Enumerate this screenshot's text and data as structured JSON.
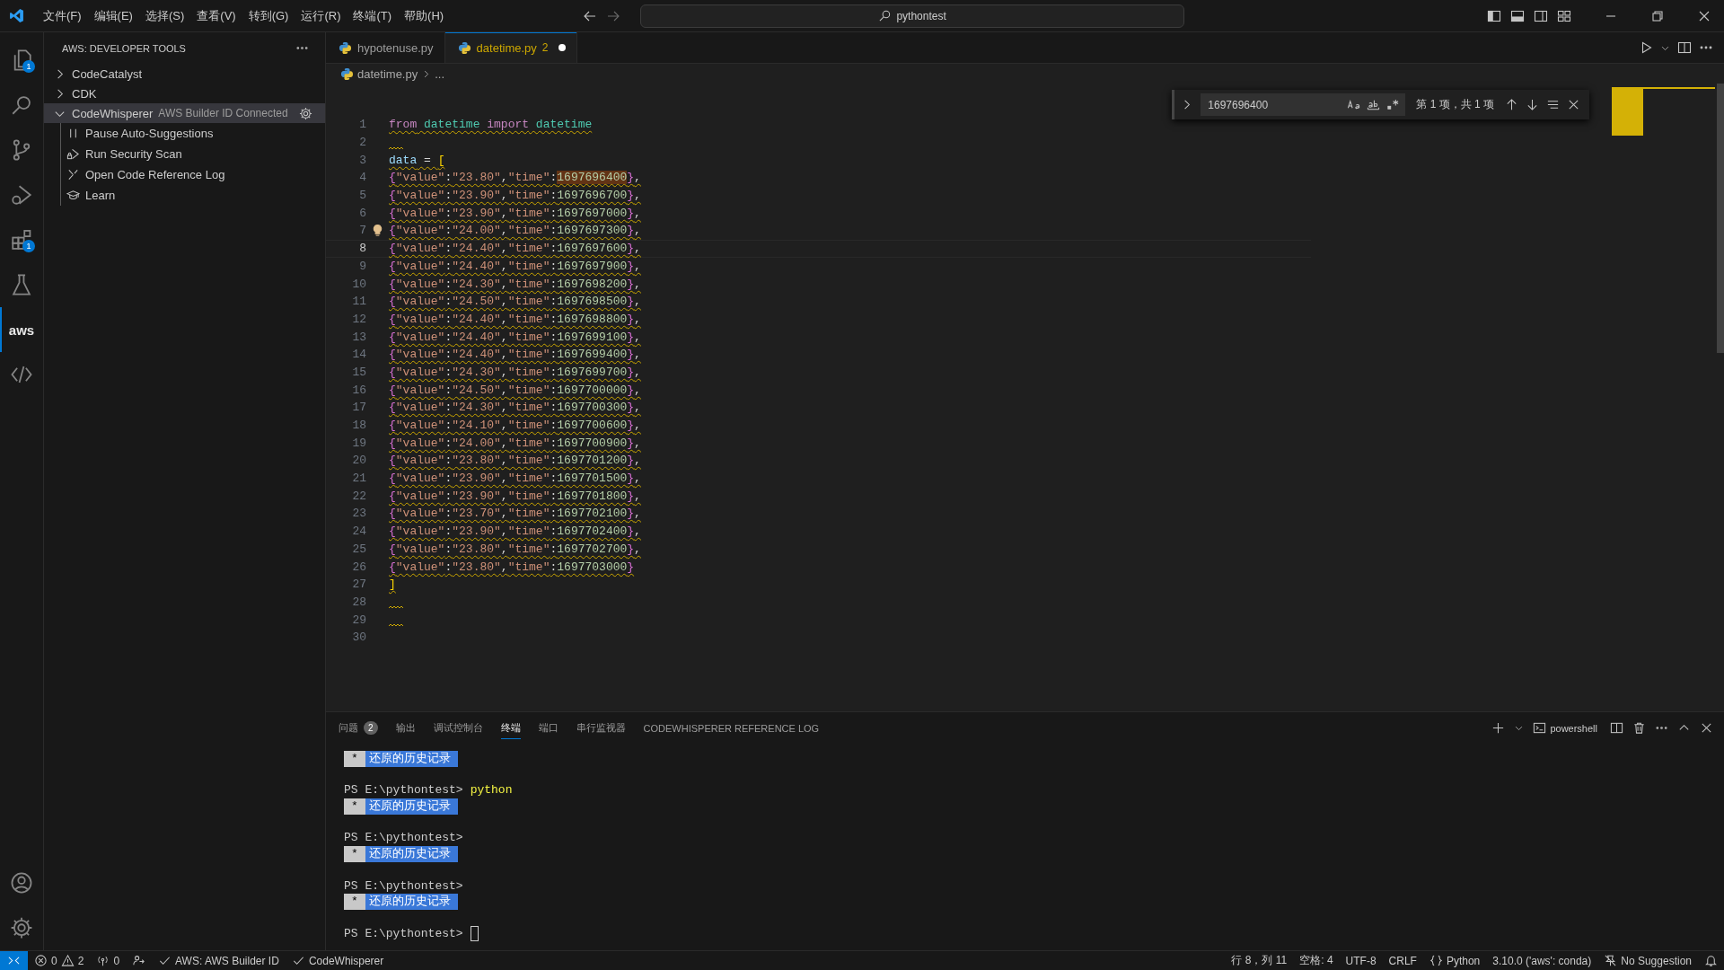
{
  "title_bar": {
    "menus": [
      "文件(F)",
      "编辑(E)",
      "选择(S)",
      "查看(V)",
      "转到(G)",
      "运行(R)",
      "终端(T)",
      "帮助(H)"
    ],
    "search": "pythontest"
  },
  "activity_bar": {
    "items": [
      {
        "kind": "files",
        "badge": "1",
        "selected": false
      },
      {
        "kind": "search",
        "selected": false
      },
      {
        "kind": "source-control",
        "selected": false
      },
      {
        "kind": "run-debug",
        "selected": false
      },
      {
        "kind": "extensions",
        "badge": "1",
        "selected": false
      },
      {
        "kind": "testing",
        "selected": false
      },
      {
        "kind": "aws",
        "label": "aws",
        "selected": true
      },
      {
        "kind": "code",
        "selected": false
      }
    ],
    "bottom": [
      {
        "kind": "account"
      },
      {
        "kind": "settings"
      }
    ]
  },
  "sidebar": {
    "title": "AWS: DEVELOPER TOOLS",
    "items": [
      {
        "label": "CodeCatalyst",
        "expanded": false,
        "selected": false
      },
      {
        "label": "CDK",
        "expanded": false,
        "selected": false
      },
      {
        "label": "CodeWhisperer",
        "description": "AWS Builder ID Connected",
        "expanded": true,
        "selected": true,
        "children": [
          {
            "kind": "pause",
            "label": "Pause Auto-Suggestions"
          },
          {
            "kind": "security-scan",
            "label": "Run Security Scan"
          },
          {
            "kind": "reference-log",
            "label": "Open Code Reference Log"
          },
          {
            "kind": "learn",
            "label": "Learn"
          }
        ]
      }
    ]
  },
  "editor": {
    "tabs": [
      {
        "label": "hypotenuse.py",
        "selected": false,
        "modified": false
      },
      {
        "label": "datetime.py",
        "problems": "2",
        "selected": true,
        "modified": true
      }
    ],
    "breadcrumb": [
      "datetime.py",
      "..."
    ],
    "find": {
      "value": "1697696400",
      "match_case": false,
      "whole_word": false,
      "regex": false,
      "result": "第 1 项，共 1 项"
    },
    "lines": [
      {
        "number": "1",
        "warning": true,
        "current": false,
        "tokens": [
          {
            "kind": "kw",
            "text": "from"
          },
          {
            "kind": "mod",
            "text": " datetime"
          },
          {
            "kind": "kw",
            "text": " import"
          },
          {
            "kind": "mod",
            "text": " datetime"
          }
        ]
      },
      {
        "number": "2",
        "warning": true,
        "current": false
      },
      {
        "number": "3",
        "warning": true,
        "current": false,
        "tokens": [
          {
            "kind": "var",
            "text": "data"
          },
          {
            "kind": "op",
            "text": " = "
          },
          {
            "kind": "bracket",
            "text": "["
          }
        ]
      },
      {
        "number": "4",
        "warning": true,
        "current": false,
        "tokens": [
          {
            "kind": "brace",
            "text": "{"
          },
          {
            "kind": "str",
            "text": "\"value\""
          },
          {
            "kind": "op",
            "text": ":"
          },
          {
            "kind": "str",
            "text": "\"23.80\""
          },
          {
            "kind": "op",
            "text": ","
          },
          {
            "kind": "str",
            "text": "\"time\""
          },
          {
            "kind": "op",
            "text": ":"
          },
          {
            "kind": "num",
            "text": "1697696400",
            "match": true
          },
          {
            "kind": "brace",
            "text": "}"
          },
          {
            "kind": "op",
            "text": ","
          }
        ]
      },
      {
        "number": "5",
        "warning": true,
        "current": false,
        "tokens": [
          {
            "kind": "brace",
            "text": "{"
          },
          {
            "kind": "str",
            "text": "\"value\""
          },
          {
            "kind": "op",
            "text": ":"
          },
          {
            "kind": "str",
            "text": "\"23.90\""
          },
          {
            "kind": "op",
            "text": ","
          },
          {
            "kind": "str",
            "text": "\"time\""
          },
          {
            "kind": "op",
            "text": ":"
          },
          {
            "kind": "num",
            "text": "1697696700"
          },
          {
            "kind": "brace",
            "text": "}"
          },
          {
            "kind": "op",
            "text": ","
          }
        ]
      },
      {
        "number": "6",
        "warning": true,
        "current": false,
        "tokens": [
          {
            "kind": "brace",
            "text": "{"
          },
          {
            "kind": "str",
            "text": "\"value\""
          },
          {
            "kind": "op",
            "text": ":"
          },
          {
            "kind": "str",
            "text": "\"23.90\""
          },
          {
            "kind": "op",
            "text": ","
          },
          {
            "kind": "str",
            "text": "\"time\""
          },
          {
            "kind": "op",
            "text": ":"
          },
          {
            "kind": "num",
            "text": "1697697000"
          },
          {
            "kind": "brace",
            "text": "}"
          },
          {
            "kind": "op",
            "text": ","
          }
        ]
      },
      {
        "number": "7",
        "warning": true,
        "current": false,
        "lightbulb": true,
        "tokens": [
          {
            "kind": "brace",
            "text": "{"
          },
          {
            "kind": "str",
            "text": "\"value\""
          },
          {
            "kind": "op",
            "text": ":"
          },
          {
            "kind": "str",
            "text": "\"24.00\""
          },
          {
            "kind": "op",
            "text": ","
          },
          {
            "kind": "str",
            "text": "\"time\""
          },
          {
            "kind": "op",
            "text": ":"
          },
          {
            "kind": "num",
            "text": "1697697300"
          },
          {
            "kind": "brace",
            "text": "}"
          },
          {
            "kind": "op",
            "text": ","
          }
        ]
      },
      {
        "number": "8",
        "warning": true,
        "current": true,
        "tokens": [
          {
            "kind": "brace",
            "text": "{"
          },
          {
            "kind": "str",
            "text": "\"value\""
          },
          {
            "kind": "op",
            "text": ":"
          },
          {
            "kind": "str",
            "text": "\"24.40\""
          },
          {
            "kind": "op",
            "text": ","
          },
          {
            "kind": "str",
            "text": "\"time\""
          },
          {
            "kind": "op",
            "text": ":"
          },
          {
            "kind": "num",
            "text": "1697697600"
          },
          {
            "kind": "brace",
            "text": "}"
          },
          {
            "kind": "op",
            "text": ","
          }
        ]
      },
      {
        "number": "9",
        "warning": true,
        "current": false,
        "tokens": [
          {
            "kind": "brace",
            "text": "{"
          },
          {
            "kind": "str",
            "text": "\"value\""
          },
          {
            "kind": "op",
            "text": ":"
          },
          {
            "kind": "str",
            "text": "\"24.40\""
          },
          {
            "kind": "op",
            "text": ","
          },
          {
            "kind": "str",
            "text": "\"time\""
          },
          {
            "kind": "op",
            "text": ":"
          },
          {
            "kind": "num",
            "text": "1697697900"
          },
          {
            "kind": "brace",
            "text": "}"
          },
          {
            "kind": "op",
            "text": ","
          }
        ]
      },
      {
        "number": "10",
        "warning": true,
        "current": false,
        "tokens": [
          {
            "kind": "brace",
            "text": "{"
          },
          {
            "kind": "str",
            "text": "\"value\""
          },
          {
            "kind": "op",
            "text": ":"
          },
          {
            "kind": "str",
            "text": "\"24.30\""
          },
          {
            "kind": "op",
            "text": ","
          },
          {
            "kind": "str",
            "text": "\"time\""
          },
          {
            "kind": "op",
            "text": ":"
          },
          {
            "kind": "num",
            "text": "1697698200"
          },
          {
            "kind": "brace",
            "text": "}"
          },
          {
            "kind": "op",
            "text": ","
          }
        ]
      },
      {
        "number": "11",
        "warning": true,
        "current": false,
        "tokens": [
          {
            "kind": "brace",
            "text": "{"
          },
          {
            "kind": "str",
            "text": "\"value\""
          },
          {
            "kind": "op",
            "text": ":"
          },
          {
            "kind": "str",
            "text": "\"24.50\""
          },
          {
            "kind": "op",
            "text": ","
          },
          {
            "kind": "str",
            "text": "\"time\""
          },
          {
            "kind": "op",
            "text": ":"
          },
          {
            "kind": "num",
            "text": "1697698500"
          },
          {
            "kind": "brace",
            "text": "}"
          },
          {
            "kind": "op",
            "text": ","
          }
        ]
      },
      {
        "number": "12",
        "warning": true,
        "current": false,
        "tokens": [
          {
            "kind": "brace",
            "text": "{"
          },
          {
            "kind": "str",
            "text": "\"value\""
          },
          {
            "kind": "op",
            "text": ":"
          },
          {
            "kind": "str",
            "text": "\"24.40\""
          },
          {
            "kind": "op",
            "text": ","
          },
          {
            "kind": "str",
            "text": "\"time\""
          },
          {
            "kind": "op",
            "text": ":"
          },
          {
            "kind": "num",
            "text": "1697698800"
          },
          {
            "kind": "brace",
            "text": "}"
          },
          {
            "kind": "op",
            "text": ","
          }
        ]
      },
      {
        "number": "13",
        "warning": true,
        "current": false,
        "tokens": [
          {
            "kind": "brace",
            "text": "{"
          },
          {
            "kind": "str",
            "text": "\"value\""
          },
          {
            "kind": "op",
            "text": ":"
          },
          {
            "kind": "str",
            "text": "\"24.40\""
          },
          {
            "kind": "op",
            "text": ","
          },
          {
            "kind": "str",
            "text": "\"time\""
          },
          {
            "kind": "op",
            "text": ":"
          },
          {
            "kind": "num",
            "text": "1697699100"
          },
          {
            "kind": "brace",
            "text": "}"
          },
          {
            "kind": "op",
            "text": ","
          }
        ]
      },
      {
        "number": "14",
        "warning": true,
        "current": false,
        "tokens": [
          {
            "kind": "brace",
            "text": "{"
          },
          {
            "kind": "str",
            "text": "\"value\""
          },
          {
            "kind": "op",
            "text": ":"
          },
          {
            "kind": "str",
            "text": "\"24.40\""
          },
          {
            "kind": "op",
            "text": ","
          },
          {
            "kind": "str",
            "text": "\"time\""
          },
          {
            "kind": "op",
            "text": ":"
          },
          {
            "kind": "num",
            "text": "1697699400"
          },
          {
            "kind": "brace",
            "text": "}"
          },
          {
            "kind": "op",
            "text": ","
          }
        ]
      },
      {
        "number": "15",
        "warning": true,
        "current": false,
        "tokens": [
          {
            "kind": "brace",
            "text": "{"
          },
          {
            "kind": "str",
            "text": "\"value\""
          },
          {
            "kind": "op",
            "text": ":"
          },
          {
            "kind": "str",
            "text": "\"24.30\""
          },
          {
            "kind": "op",
            "text": ","
          },
          {
            "kind": "str",
            "text": "\"time\""
          },
          {
            "kind": "op",
            "text": ":"
          },
          {
            "kind": "num",
            "text": "1697699700"
          },
          {
            "kind": "brace",
            "text": "}"
          },
          {
            "kind": "op",
            "text": ","
          }
        ]
      },
      {
        "number": "16",
        "warning": true,
        "current": false,
        "tokens": [
          {
            "kind": "brace",
            "text": "{"
          },
          {
            "kind": "str",
            "text": "\"value\""
          },
          {
            "kind": "op",
            "text": ":"
          },
          {
            "kind": "str",
            "text": "\"24.50\""
          },
          {
            "kind": "op",
            "text": ","
          },
          {
            "kind": "str",
            "text": "\"time\""
          },
          {
            "kind": "op",
            "text": ":"
          },
          {
            "kind": "num",
            "text": "1697700000"
          },
          {
            "kind": "brace",
            "text": "}"
          },
          {
            "kind": "op",
            "text": ","
          }
        ]
      },
      {
        "number": "17",
        "warning": true,
        "current": false,
        "tokens": [
          {
            "kind": "brace",
            "text": "{"
          },
          {
            "kind": "str",
            "text": "\"value\""
          },
          {
            "kind": "op",
            "text": ":"
          },
          {
            "kind": "str",
            "text": "\"24.30\""
          },
          {
            "kind": "op",
            "text": ","
          },
          {
            "kind": "str",
            "text": "\"time\""
          },
          {
            "kind": "op",
            "text": ":"
          },
          {
            "kind": "num",
            "text": "1697700300"
          },
          {
            "kind": "brace",
            "text": "}"
          },
          {
            "kind": "op",
            "text": ","
          }
        ]
      },
      {
        "number": "18",
        "warning": true,
        "current": false,
        "tokens": [
          {
            "kind": "brace",
            "text": "{"
          },
          {
            "kind": "str",
            "text": "\"value\""
          },
          {
            "kind": "op",
            "text": ":"
          },
          {
            "kind": "str",
            "text": "\"24.10\""
          },
          {
            "kind": "op",
            "text": ","
          },
          {
            "kind": "str",
            "text": "\"time\""
          },
          {
            "kind": "op",
            "text": ":"
          },
          {
            "kind": "num",
            "text": "1697700600"
          },
          {
            "kind": "brace",
            "text": "}"
          },
          {
            "kind": "op",
            "text": ","
          }
        ]
      },
      {
        "number": "19",
        "warning": true,
        "current": false,
        "tokens": [
          {
            "kind": "brace",
            "text": "{"
          },
          {
            "kind": "str",
            "text": "\"value\""
          },
          {
            "kind": "op",
            "text": ":"
          },
          {
            "kind": "str",
            "text": "\"24.00\""
          },
          {
            "kind": "op",
            "text": ","
          },
          {
            "kind": "str",
            "text": "\"time\""
          },
          {
            "kind": "op",
            "text": ":"
          },
          {
            "kind": "num",
            "text": "1697700900"
          },
          {
            "kind": "brace",
            "text": "}"
          },
          {
            "kind": "op",
            "text": ","
          }
        ]
      },
      {
        "number": "20",
        "warning": true,
        "current": false,
        "tokens": [
          {
            "kind": "brace",
            "text": "{"
          },
          {
            "kind": "str",
            "text": "\"value\""
          },
          {
            "kind": "op",
            "text": ":"
          },
          {
            "kind": "str",
            "text": "\"23.80\""
          },
          {
            "kind": "op",
            "text": ","
          },
          {
            "kind": "str",
            "text": "\"time\""
          },
          {
            "kind": "op",
            "text": ":"
          },
          {
            "kind": "num",
            "text": "1697701200"
          },
          {
            "kind": "brace",
            "text": "}"
          },
          {
            "kind": "op",
            "text": ","
          }
        ]
      },
      {
        "number": "21",
        "warning": true,
        "current": false,
        "tokens": [
          {
            "kind": "brace",
            "text": "{"
          },
          {
            "kind": "str",
            "text": "\"value\""
          },
          {
            "kind": "op",
            "text": ":"
          },
          {
            "kind": "str",
            "text": "\"23.90\""
          },
          {
            "kind": "op",
            "text": ","
          },
          {
            "kind": "str",
            "text": "\"time\""
          },
          {
            "kind": "op",
            "text": ":"
          },
          {
            "kind": "num",
            "text": "1697701500"
          },
          {
            "kind": "brace",
            "text": "}"
          },
          {
            "kind": "op",
            "text": ","
          }
        ]
      },
      {
        "number": "22",
        "warning": true,
        "current": false,
        "tokens": [
          {
            "kind": "brace",
            "text": "{"
          },
          {
            "kind": "str",
            "text": "\"value\""
          },
          {
            "kind": "op",
            "text": ":"
          },
          {
            "kind": "str",
            "text": "\"23.90\""
          },
          {
            "kind": "op",
            "text": ","
          },
          {
            "kind": "str",
            "text": "\"time\""
          },
          {
            "kind": "op",
            "text": ":"
          },
          {
            "kind": "num",
            "text": "1697701800"
          },
          {
            "kind": "brace",
            "text": "}"
          },
          {
            "kind": "op",
            "text": ","
          }
        ]
      },
      {
        "number": "23",
        "warning": true,
        "current": false,
        "tokens": [
          {
            "kind": "brace",
            "text": "{"
          },
          {
            "kind": "str",
            "text": "\"value\""
          },
          {
            "kind": "op",
            "text": ":"
          },
          {
            "kind": "str",
            "text": "\"23.70\""
          },
          {
            "kind": "op",
            "text": ","
          },
          {
            "kind": "str",
            "text": "\"time\""
          },
          {
            "kind": "op",
            "text": ":"
          },
          {
            "kind": "num",
            "text": "1697702100"
          },
          {
            "kind": "brace",
            "text": "}"
          },
          {
            "kind": "op",
            "text": ","
          }
        ]
      },
      {
        "number": "24",
        "warning": true,
        "current": false,
        "tokens": [
          {
            "kind": "brace",
            "text": "{"
          },
          {
            "kind": "str",
            "text": "\"value\""
          },
          {
            "kind": "op",
            "text": ":"
          },
          {
            "kind": "str",
            "text": "\"23.90\""
          },
          {
            "kind": "op",
            "text": ","
          },
          {
            "kind": "str",
            "text": "\"time\""
          },
          {
            "kind": "op",
            "text": ":"
          },
          {
            "kind": "num",
            "text": "1697702400"
          },
          {
            "kind": "brace",
            "text": "}"
          },
          {
            "kind": "op",
            "text": ","
          }
        ]
      },
      {
        "number": "25",
        "warning": true,
        "current": false,
        "tokens": [
          {
            "kind": "brace",
            "text": "{"
          },
          {
            "kind": "str",
            "text": "\"value\""
          },
          {
            "kind": "op",
            "text": ":"
          },
          {
            "kind": "str",
            "text": "\"23.80\""
          },
          {
            "kind": "op",
            "text": ","
          },
          {
            "kind": "str",
            "text": "\"time\""
          },
          {
            "kind": "op",
            "text": ":"
          },
          {
            "kind": "num",
            "text": "1697702700"
          },
          {
            "kind": "brace",
            "text": "}"
          },
          {
            "kind": "op",
            "text": ","
          }
        ]
      },
      {
        "number": "26",
        "warning": true,
        "current": false,
        "tokens": [
          {
            "kind": "brace",
            "text": "{"
          },
          {
            "kind": "str",
            "text": "\"value\""
          },
          {
            "kind": "op",
            "text": ":"
          },
          {
            "kind": "str",
            "text": "\"23.80\""
          },
          {
            "kind": "op",
            "text": ","
          },
          {
            "kind": "str",
            "text": "\"time\""
          },
          {
            "kind": "op",
            "text": ":"
          },
          {
            "kind": "num",
            "text": "1697703000"
          },
          {
            "kind": "brace",
            "text": "}"
          }
        ]
      },
      {
        "number": "27",
        "warning": true,
        "current": false,
        "tokens": [
          {
            "kind": "bracket",
            "text": "]"
          }
        ]
      },
      {
        "number": "28",
        "warning": true,
        "current": false
      },
      {
        "number": "29",
        "warning": true,
        "current": false
      },
      {
        "number": "30",
        "warning": false,
        "current": false
      }
    ]
  },
  "panel": {
    "tabs": [
      {
        "label": "问题",
        "badge": "2",
        "selected": false
      },
      {
        "label": "输出",
        "selected": false
      },
      {
        "label": "调试控制台",
        "selected": false
      },
      {
        "label": "终端",
        "selected": true
      },
      {
        "label": "端口",
        "selected": false
      },
      {
        "label": "串行监视器",
        "selected": false
      },
      {
        "label": "CODEWHISPERER REFERENCE LOG",
        "selected": false
      }
    ],
    "profile": "powershell",
    "terminal": [
      {
        "kind": "history",
        "marker": "*",
        "text": "还原的历史记录"
      },
      {
        "kind": "prompt",
        "prompt": "PS E:\\pythontest>",
        "command": "python"
      },
      {
        "kind": "history",
        "marker": "*",
        "text": "还原的历史记录"
      },
      {
        "kind": "prompt",
        "prompt": "PS E:\\pythontest>"
      },
      {
        "kind": "history",
        "marker": "*",
        "text": "还原的历史记录"
      },
      {
        "kind": "prompt",
        "prompt": "PS E:\\pythontest>"
      },
      {
        "kind": "history",
        "marker": "*",
        "text": "还原的历史记录"
      },
      {
        "kind": "prompt",
        "prompt": "PS E:\\pythontest>",
        "cursor": true
      }
    ]
  },
  "status_bar": {
    "left": [
      {
        "kind": "remote"
      },
      {
        "kind": "problems",
        "errors": "0",
        "warnings": "2"
      },
      {
        "kind": "ports",
        "text": "0"
      },
      {
        "kind": "live-share"
      },
      {
        "kind": "check",
        "text": "AWS: AWS Builder ID"
      },
      {
        "kind": "check",
        "text": "CodeWhisperer"
      }
    ],
    "right": [
      {
        "kind": "text",
        "text": "行 8，列 11"
      },
      {
        "kind": "text",
        "text": "空格: 4"
      },
      {
        "kind": "text",
        "text": "UTF-8"
      },
      {
        "kind": "text",
        "text": "CRLF"
      },
      {
        "kind": "language",
        "text": "Python"
      },
      {
        "kind": "text",
        "text": "3.10.0 ('aws': conda)"
      },
      {
        "kind": "suggestion",
        "text": "No Suggestion"
      },
      {
        "kind": "bell"
      }
    ]
  }
}
